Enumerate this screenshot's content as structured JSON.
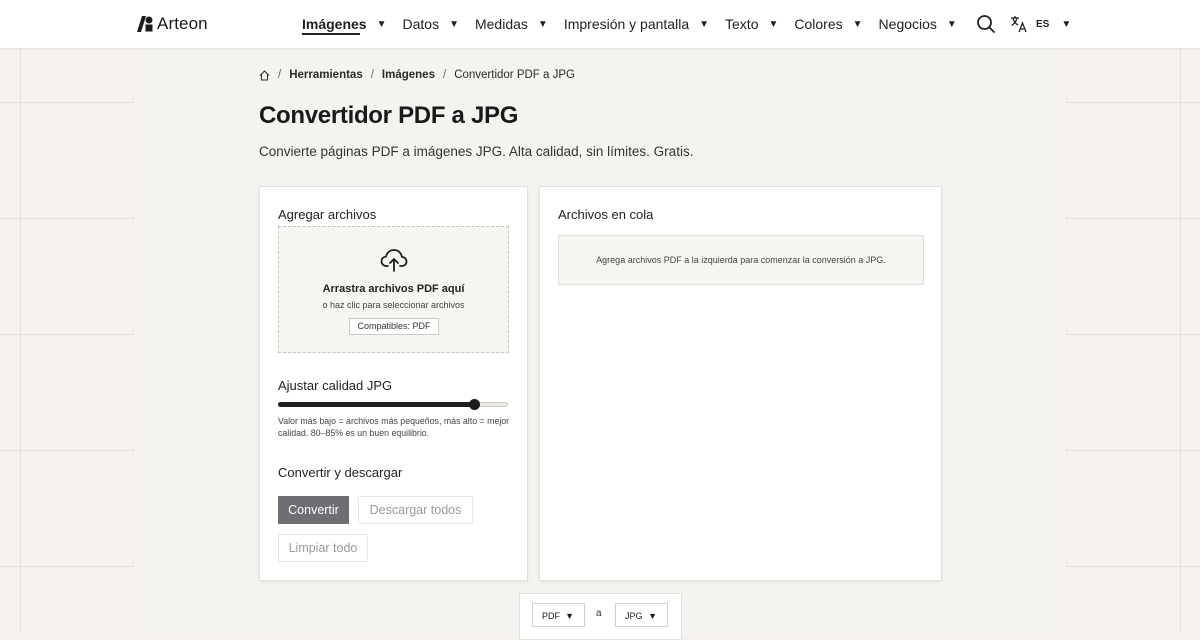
{
  "brand": {
    "name": "Arteon"
  },
  "nav": {
    "items": [
      {
        "label": "Imágenes",
        "active": true
      },
      {
        "label": "Datos"
      },
      {
        "label": "Medidas"
      },
      {
        "label": "Impresión y pantalla"
      },
      {
        "label": "Texto"
      },
      {
        "label": "Colores"
      },
      {
        "label": "Negocios"
      }
    ],
    "caret": "▼",
    "search_icon": "search-icon",
    "language": {
      "code": "ES",
      "icon": "translate-icon"
    }
  },
  "breadcrumb": {
    "home_icon": "home-icon",
    "sep": "/",
    "items": [
      "Herramientas",
      "Imágenes",
      "Convertidor PDF a JPG"
    ]
  },
  "page": {
    "title": "Convertidor PDF a JPG",
    "subtitle": "Convierte páginas PDF a imágenes JPG. Alta calidad, sin límites. Gratis."
  },
  "left_card": {
    "add_title": "Agregar archivos",
    "dropzone": {
      "icon": "cloud-upload-icon",
      "title": "Arrastra archivos PDF aquí",
      "subtitle": "o haz clic para seleccionar archivos",
      "badge": "Compatibles: PDF"
    },
    "quality": {
      "title": "Ajustar calidad JPG",
      "value": 0.85,
      "hint": "Valor más bajo = archivos más pequeños, más alto = mejor calidad. 80–85% es un buen equilibrio."
    },
    "convert_section": {
      "title": "Convertir y descargar",
      "convert_label": "Convertir",
      "download_all_label": "Descargar todos",
      "clear_all_label": "Limpiar todo"
    }
  },
  "right_card": {
    "title": "Archivos en cola",
    "empty_message": "Agrega archivos PDF a la izquierda para comenzar la conversión a JPG."
  },
  "converter": {
    "from": "PDF",
    "to_word": "a",
    "to": "JPG",
    "caret": "▼"
  },
  "colors": {
    "primary_button": "#6f6e73",
    "background": "#f6f3ef",
    "text": "#1f1f1f"
  }
}
